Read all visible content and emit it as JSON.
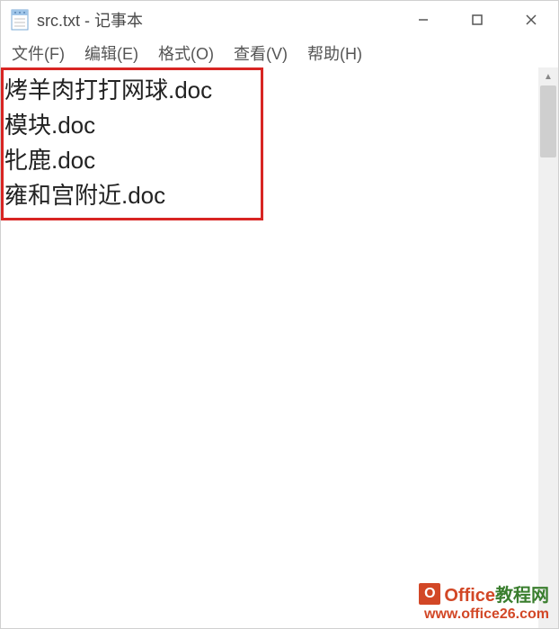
{
  "window": {
    "title": "src.txt - 记事本"
  },
  "menu": {
    "file": "文件(F)",
    "edit": "编辑(E)",
    "format": "格式(O)",
    "view": "查看(V)",
    "help": "帮助(H)"
  },
  "content": {
    "lines": [
      "烤羊肉打打网球.doc",
      "模块.doc",
      "牝鹿.doc",
      "雍和宫附近.doc"
    ]
  },
  "watermark": {
    "logo_letter": "O",
    "brand_office": "Office",
    "brand_rest": "教程网",
    "url": "www.office26.com"
  },
  "colors": {
    "highlight_border": "#d82523",
    "brand_orange": "#d24726",
    "brand_green": "#3a7e2e"
  }
}
